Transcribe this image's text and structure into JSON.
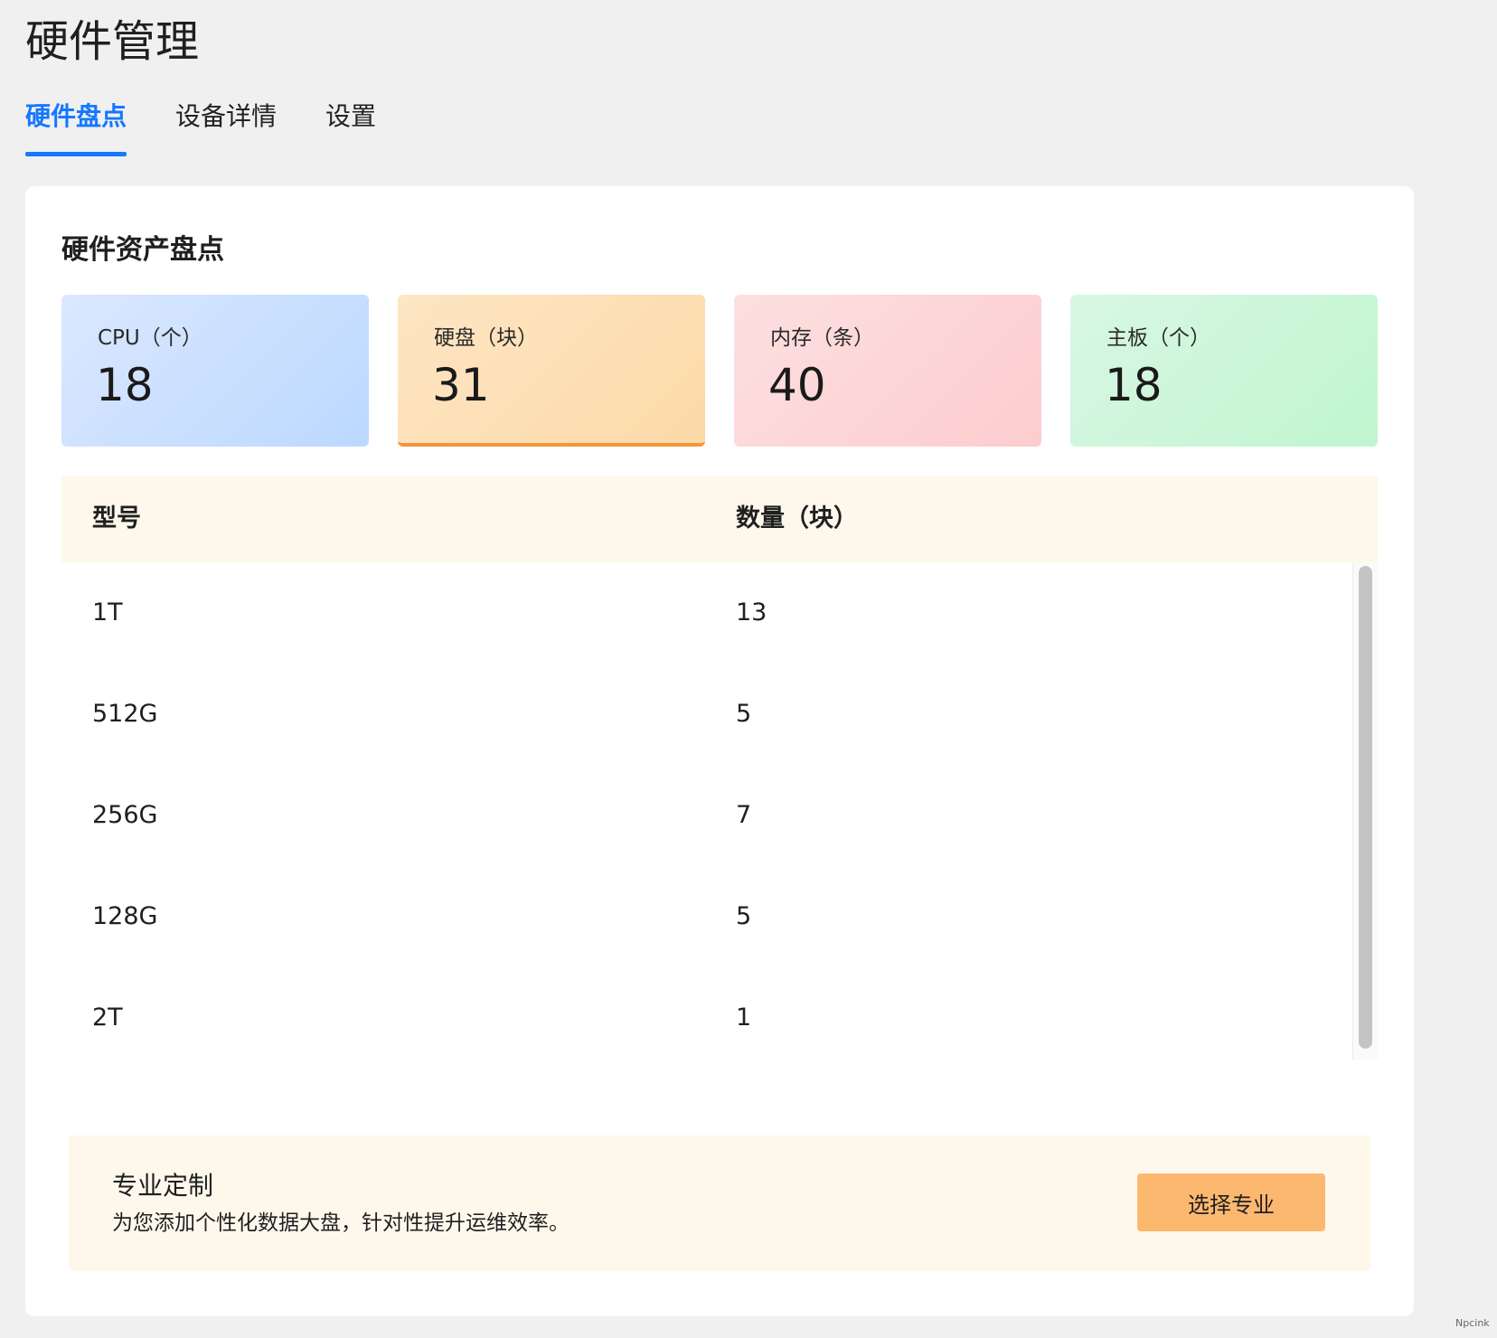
{
  "page_title": "硬件管理",
  "tabs": [
    {
      "label": "硬件盘点",
      "active": true
    },
    {
      "label": "设备详情",
      "active": false
    },
    {
      "label": "设置",
      "active": false
    }
  ],
  "section_title": "硬件资产盘点",
  "stats": [
    {
      "label": "CPU（个）",
      "value": "18"
    },
    {
      "label": "硬盘（块）",
      "value": "31",
      "selected": true
    },
    {
      "label": "内存（条）",
      "value": "40"
    },
    {
      "label": "主板（个）",
      "value": "18"
    }
  ],
  "table": {
    "headers": [
      "型号",
      "数量（块）"
    ],
    "rows": [
      {
        "model": "1T",
        "qty": "13"
      },
      {
        "model": "512G",
        "qty": "5"
      },
      {
        "model": "256G",
        "qty": "7"
      },
      {
        "model": "128G",
        "qty": "5"
      },
      {
        "model": "2T",
        "qty": "1"
      }
    ]
  },
  "promo": {
    "title": "专业定制",
    "description": "为您添加个性化数据大盘，针对性提升运维效率。",
    "button_label": "选择专业"
  },
  "watermark": "Npcink",
  "colors": {
    "accent": "#1677ff",
    "cpu_card": "#c9dffe",
    "disk_card": "#fde0b8",
    "disk_card_border": "#f2963c",
    "memory_card": "#fdd6d8",
    "board_card": "#ccf6da",
    "table_header_bg": "#fef8ec",
    "promo_bg": "#fef8ec",
    "promo_button": "#fdb870"
  }
}
